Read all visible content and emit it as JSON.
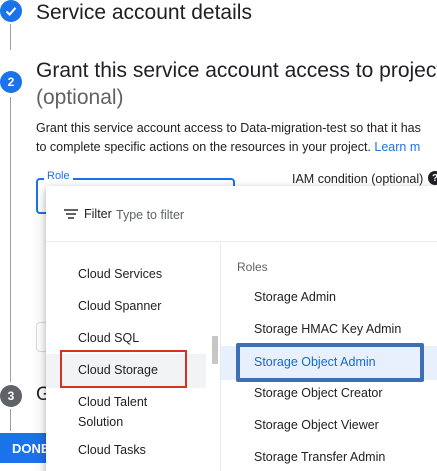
{
  "step1": {
    "title": "Service account details"
  },
  "step2": {
    "number": "2",
    "title": "Grant this service account access to project",
    "optional": "(optional)",
    "description_line1": "Grant this service account access to Data-migration-test so that it has",
    "description_line2": "to complete specific actions on the resources in your project.",
    "learn_more": "Learn m"
  },
  "role_field": {
    "label": "Role"
  },
  "iam_condition": {
    "label": "IAM condition (optional)"
  },
  "step3": {
    "number": "3",
    "title_partial": "G"
  },
  "done_button": {
    "label": "DONE"
  },
  "dropdown": {
    "filter_label": "Filter",
    "filter_placeholder": "Type to filter",
    "services": [
      {
        "label": "Cloud Services"
      },
      {
        "label": "Cloud Spanner"
      },
      {
        "label": "Cloud SQL"
      },
      {
        "label": "Cloud Storage",
        "selected": true
      },
      {
        "label": "Cloud Talent Solution"
      },
      {
        "label": "Cloud Tasks"
      }
    ],
    "roles_header": "Roles",
    "roles": [
      {
        "label": "Storage Admin"
      },
      {
        "label": "Storage HMAC Key Admin"
      },
      {
        "label": "Storage Object Admin",
        "active": true
      },
      {
        "label": "Storage Object Creator"
      },
      {
        "label": "Storage Object Viewer"
      },
      {
        "label": "Storage Transfer Admin"
      }
    ]
  },
  "colors": {
    "accent": "#1a73e8",
    "highlight_red": "#d93025",
    "highlight_blue": "#3c6fb4"
  }
}
